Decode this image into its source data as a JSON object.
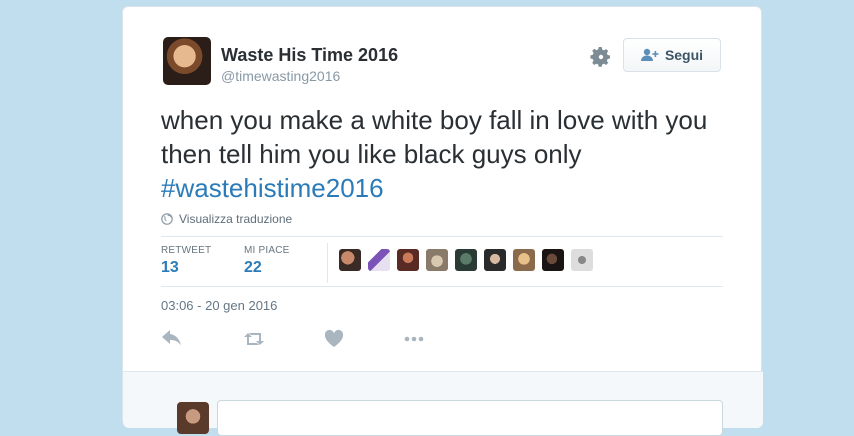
{
  "user": {
    "name": "Waste His Time 2016",
    "handle": "@timewasting2016"
  },
  "follow_button": {
    "label": "Segui",
    "icon": "person-plus-icon"
  },
  "tweet": {
    "text": "when you make a white boy fall in love with you then tell him you like black guys only",
    "hashtag": "#wastehistime2016",
    "translate_label": "Visualizza traduzione"
  },
  "stats": {
    "retweet_label": "RETWEET",
    "retweet_count": "13",
    "likes_label": "MI PIACE",
    "likes_count": "22"
  },
  "liker_avatars": 9,
  "timestamp": "03:06 - 20 gen 2016",
  "actions": [
    "reply-icon",
    "retweet-icon",
    "heart-icon",
    "more-icon"
  ],
  "colors": {
    "link": "#2b7bb9",
    "background": "#c0deed",
    "muted": "#8899a6"
  }
}
